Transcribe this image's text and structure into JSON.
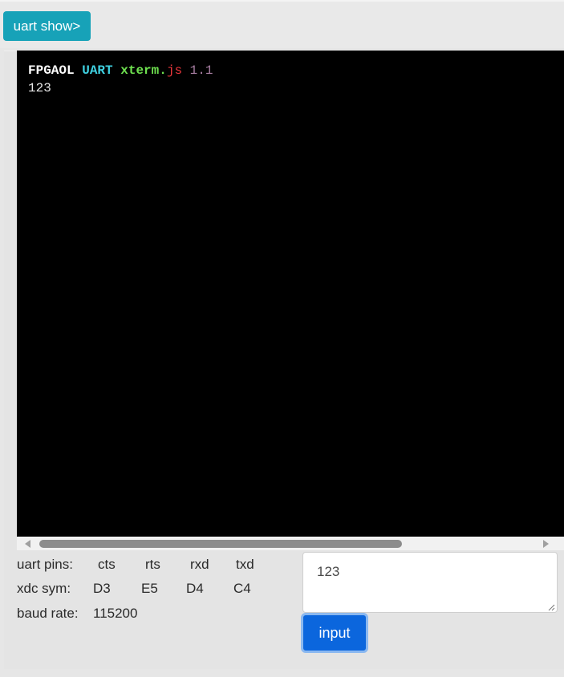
{
  "toolbar": {
    "show_button_label": "uart show>"
  },
  "terminal": {
    "banner": {
      "fpgaol": "FPGAOL",
      "uart": "UART",
      "xterm": "xterm.",
      "js": "js",
      "version": "1.1"
    },
    "output": "123"
  },
  "uart_info": {
    "pins_label": "uart pins:",
    "pins": [
      "cts",
      "rts",
      "rxd",
      "txd"
    ],
    "xdc_label": "xdc sym:",
    "xdc": [
      "D3",
      "E5",
      "D4",
      "C4"
    ],
    "baud_label": "baud rate:",
    "baud_value": "115200"
  },
  "input_area": {
    "value": "123",
    "button_label": "input"
  },
  "colors": {
    "show_button": "#17a2b8",
    "input_button": "#0b66dd",
    "terminal_bg": "#000000",
    "uart_text": "#3fd0e0",
    "xterm_text": "#6ee04f",
    "js_text": "#e8363b",
    "version_text": "#a97fa3"
  }
}
